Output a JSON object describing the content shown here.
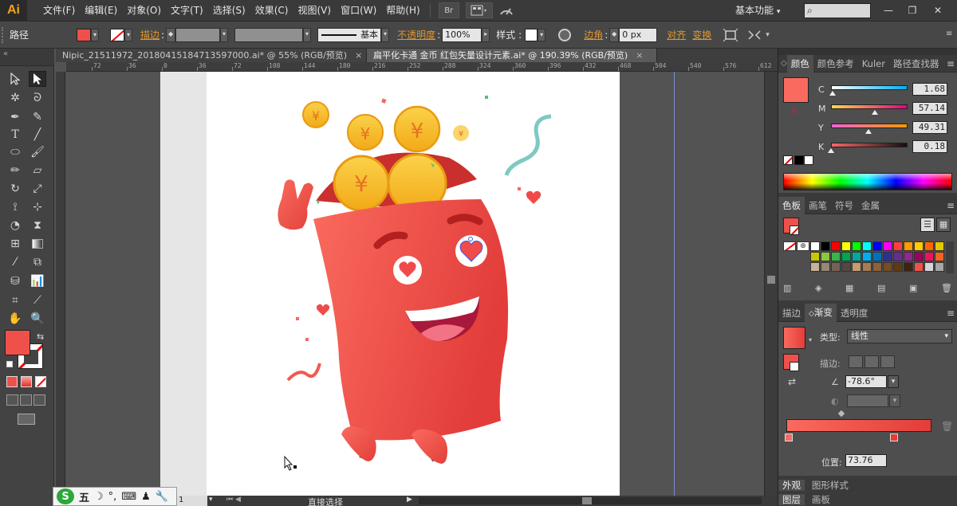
{
  "app": {
    "logo": "Ai"
  },
  "menu": [
    "文件(F)",
    "编辑(E)",
    "对象(O)",
    "文字(T)",
    "选择(S)",
    "效果(C)",
    "视图(V)",
    "窗口(W)",
    "帮助(H)"
  ],
  "menubar_icons": {
    "bridge": "Br",
    "arrange": "arrange-docs-icon",
    "gpu": "gpu-performance-icon"
  },
  "workspace": {
    "label": "基本功能"
  },
  "search": {
    "placeholder": ""
  },
  "window_controls": {
    "minimize": "—",
    "restore": "❐",
    "close": "✕"
  },
  "control": {
    "selection_label": "路径",
    "fill_color": "#f0504a",
    "stroke_label": "描边",
    "stroke_profile": "基本",
    "opacity_label": "不透明度",
    "opacity_value": "100%",
    "style_label": "样式",
    "corner_label": "边角",
    "corner_value": "0 px",
    "align_label": "对齐",
    "transform_label": "变换"
  },
  "tabs": [
    {
      "label": "Nipic_21511972_20180415184713597000.ai* @ 55% (RGB/预览)",
      "close": "×",
      "active": false
    },
    {
      "label": "扁平化卡通 金币 红包矢量设计元素.ai* @ 190.39% (RGB/预览)",
      "close": "×",
      "active": true
    }
  ],
  "ruler": {
    "ticks": [
      "72",
      "36",
      "0",
      "36",
      "72",
      "108",
      "144",
      "180",
      "216",
      "252",
      "288",
      "324",
      "360",
      "396",
      "432",
      "468",
      "504",
      "540",
      "576",
      "612"
    ]
  },
  "coin_symbol": "¥",
  "colors": {
    "accent_orange": "#e0962e",
    "envelope_light": "#fa6a5e",
    "envelope_dark": "#e23d3a",
    "coin": "#f8c426",
    "heart": "#f04a4a",
    "ribbon": "#7fc9c2"
  },
  "color_panel": {
    "tabs": [
      "颜色",
      "颜色参考",
      "Kuler",
      "路径查找器"
    ],
    "swatch": "#fa6a5e",
    "sliders": [
      {
        "label": "C",
        "value": "1.68",
        "fraction": 0.02,
        "gradient": "linear-gradient(to right,#fff,#00aeef)"
      },
      {
        "label": "M",
        "value": "57.14",
        "fraction": 0.57,
        "gradient": "linear-gradient(to right,#ffd84a,#e4007f)"
      },
      {
        "label": "Y",
        "value": "49.31",
        "fraction": 0.49,
        "gradient": "linear-gradient(to right,#f062d6,#ff9a00)"
      },
      {
        "label": "K",
        "value": "0.18",
        "fraction": 0.0,
        "gradient": "linear-gradient(to right,#f8686a,#111)"
      }
    ]
  },
  "swatches_panel": {
    "tabs": [
      "色板",
      "画笔",
      "符号",
      "金属"
    ],
    "colors": [
      "#ffffff",
      "#000000",
      "#ff0000",
      "#ffff00",
      "#00ff00",
      "#00ffff",
      "#0000ff",
      "#ff00ff",
      "#ff3f3f",
      "#ff9900",
      "#ffcc00",
      "#ff6600",
      "#e5c700",
      "#c8c800",
      "#8dc63f",
      "#39b54a",
      "#00a651",
      "#00a99d",
      "#00aeef",
      "#0072bc",
      "#2e3192",
      "#662d91",
      "#92278f",
      "#9e005d",
      "#ed145b",
      "#f26522",
      "#c7b299",
      "#998675",
      "#736357",
      "#534741",
      "#c69c6d",
      "#a67c52",
      "#8c6239",
      "#754c24",
      "#603913",
      "#3c2415",
      "#f0504a",
      "#d6d6d6",
      "#a6a6a6"
    ]
  },
  "gradient_panel": {
    "tabs": [
      "描边",
      "渐变",
      "透明度"
    ],
    "type_label": "类型",
    "type_value": "线性",
    "stroke_label": "描边",
    "angle_value": "-78.6°",
    "location_label": "位置",
    "location_value": "73.76"
  },
  "bottom_panels": [
    "外观",
    "图形样式"
  ],
  "bottom_panels2": [
    "图层",
    "画板"
  ],
  "status": {
    "zoom": "1",
    "tool_name": "直接选择"
  },
  "ime": {
    "mode": "五",
    "logo": "S"
  }
}
